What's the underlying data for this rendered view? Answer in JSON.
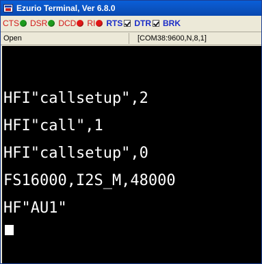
{
  "window": {
    "title": "Ezurio Terminal, Ver 6.8.0"
  },
  "indicators": [
    {
      "label": "CTS",
      "type": "led",
      "color": "#1d9a1d"
    },
    {
      "label": "DSR",
      "type": "led",
      "color": "#1d9a1d"
    },
    {
      "label": "DCD",
      "type": "led",
      "color": "#e01818"
    },
    {
      "label": "RI",
      "type": "led",
      "color": "#e01818"
    },
    {
      "label": "RTS",
      "type": "checkbox",
      "checked": true
    },
    {
      "label": "DTR",
      "type": "checkbox",
      "checked": true
    },
    {
      "label": "BRK",
      "type": "checkbox",
      "checked": false
    }
  ],
  "status": {
    "connection": "Open",
    "port_settings": "[COM38:9600,N,8,1]"
  },
  "terminal": {
    "lines": [
      "HFI\"callsetup\",2",
      "HFI\"call\",1",
      "HFI\"callsetup\",0",
      "FS16000,I2S_M,48000",
      "HF\"AU1\""
    ]
  },
  "colors": {
    "titlebar": "#0a55c8",
    "terminal_bg": "#000000",
    "terminal_fg": "#ffffff",
    "indicator_label_red": "#d21818",
    "indicator_label_blue": "#1a2cc8"
  }
}
